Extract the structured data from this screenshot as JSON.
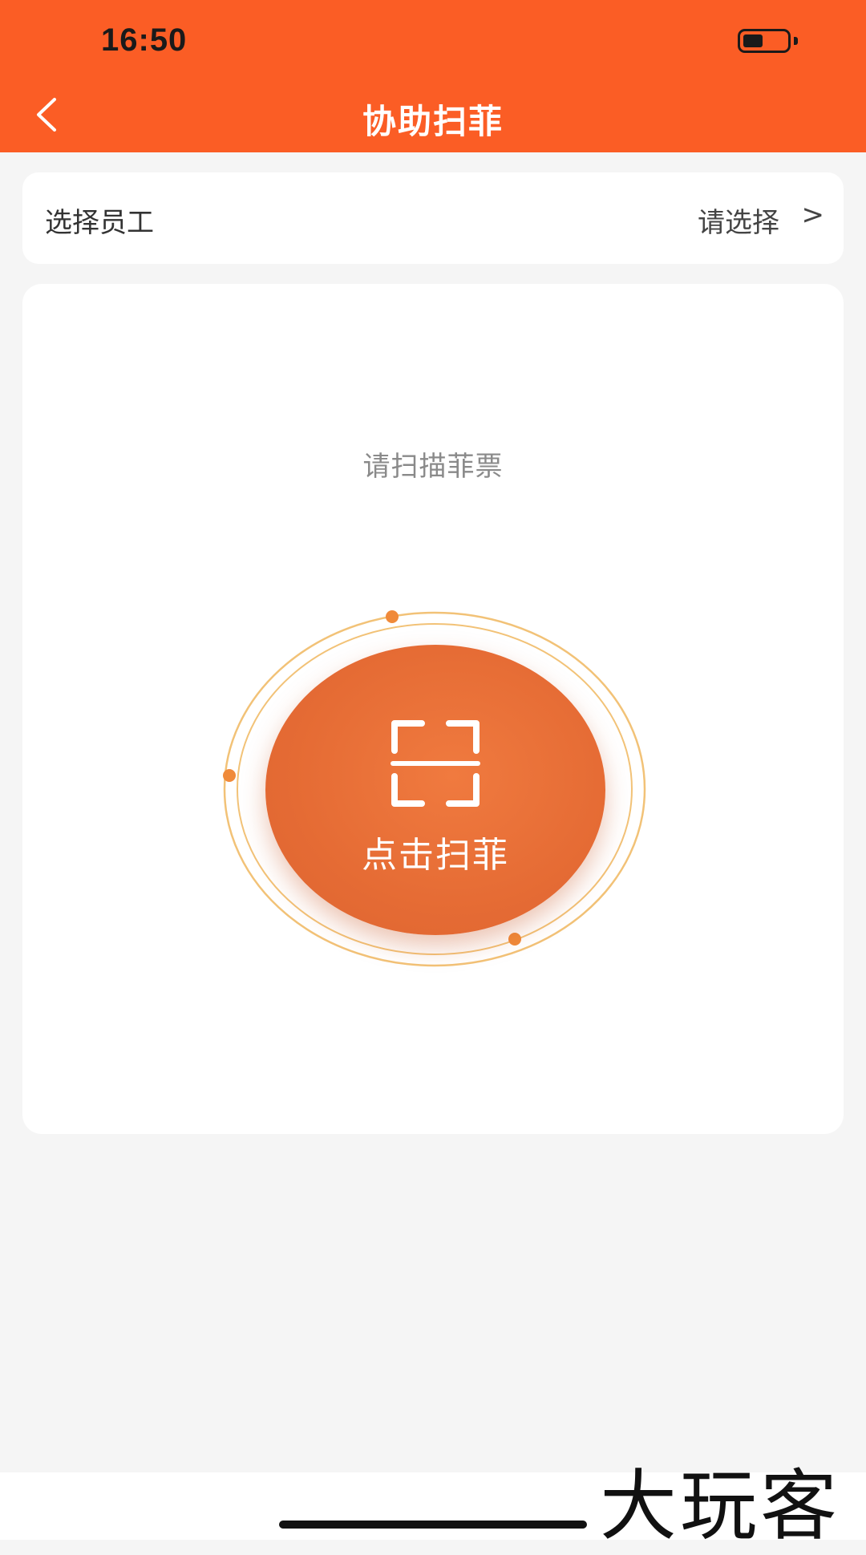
{
  "status_bar": {
    "time": "16:50"
  },
  "header": {
    "title": "协助扫菲"
  },
  "employee_select": {
    "label": "选择员工",
    "value": "请选择",
    "chevron": ">"
  },
  "scan_card": {
    "prompt": "请扫描菲票",
    "button_label": "点击扫菲"
  },
  "watermark": {
    "text": "大玩客"
  },
  "colors": {
    "brand": "#fb5d25",
    "button": "#e56b34",
    "ring": "#f2c277",
    "dot": "#f08a3a"
  },
  "icons": [
    "chevron-left-icon",
    "battery-icon",
    "scan-frame-icon",
    "chevron-right-icon"
  ]
}
